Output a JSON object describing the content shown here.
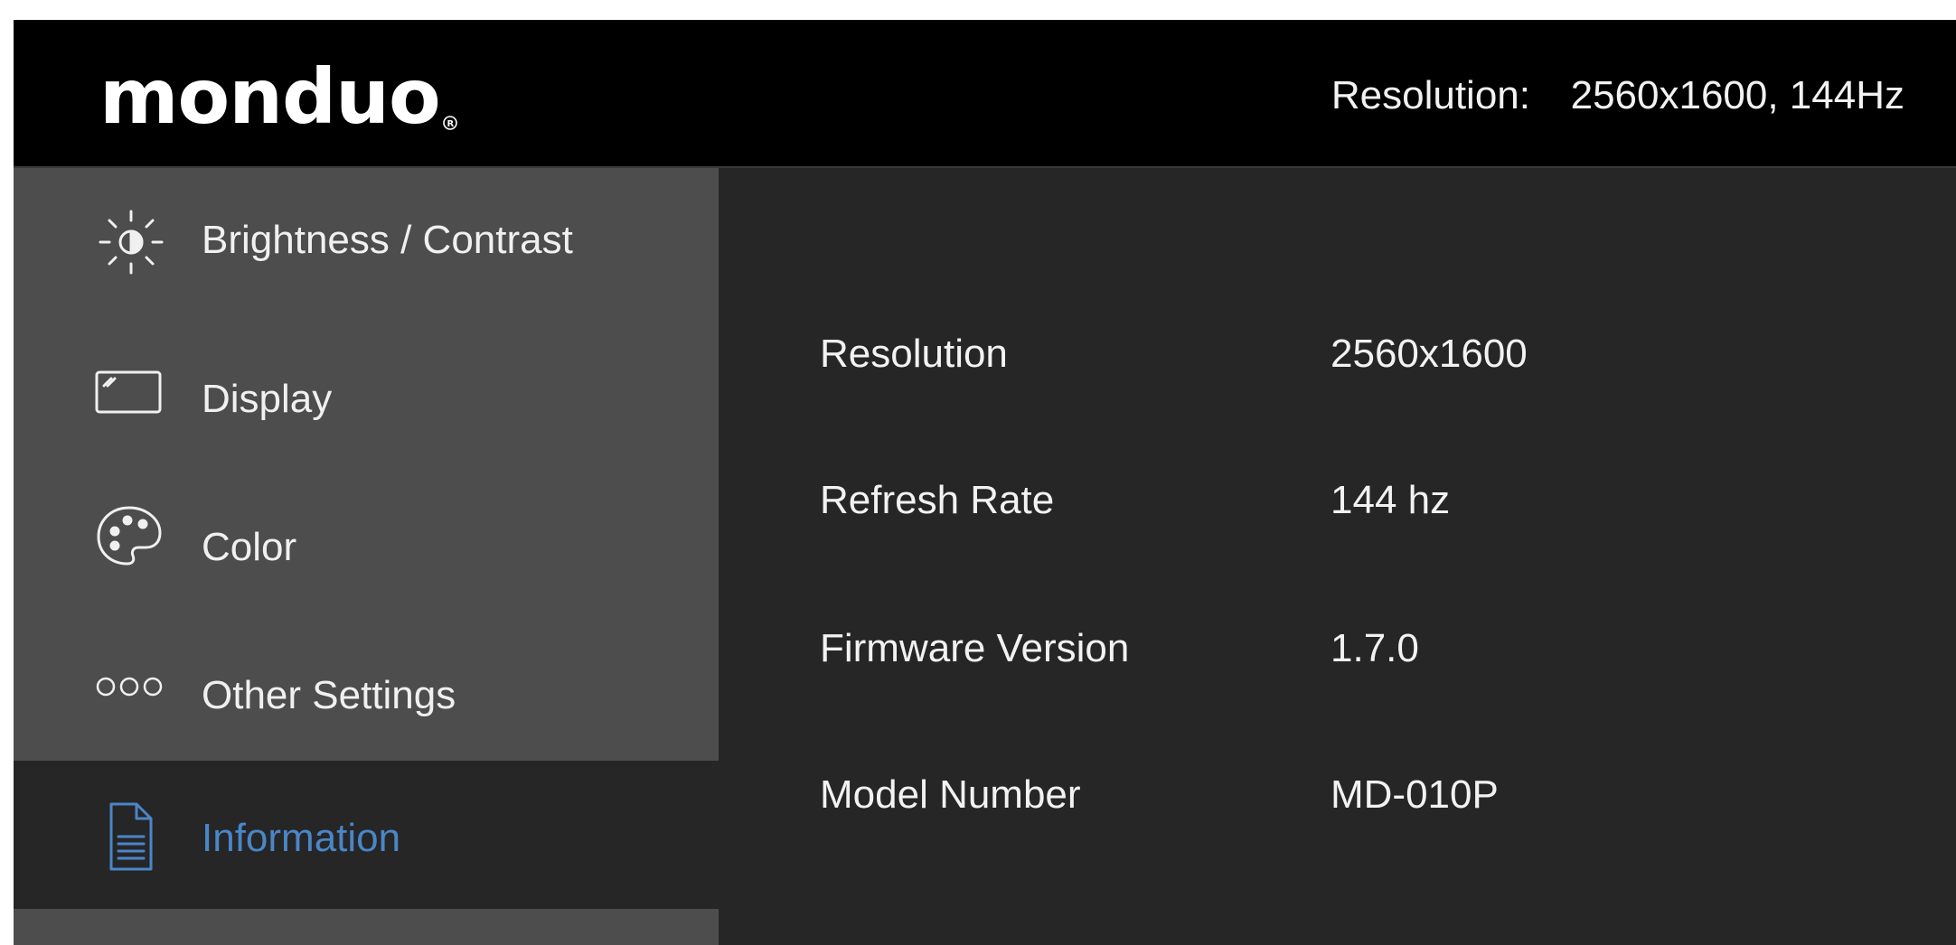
{
  "header": {
    "logo_text": "monduo",
    "resolution_label": "Resolution:",
    "resolution_value": "2560x1600, 144Hz"
  },
  "sidebar": {
    "items": [
      {
        "label": "Brightness / Contrast",
        "icon": "brightness-icon"
      },
      {
        "label": "Display",
        "icon": "display-icon"
      },
      {
        "label": "Color",
        "icon": "palette-icon"
      },
      {
        "label": "Other Settings",
        "icon": "more-dots-icon"
      },
      {
        "label": "Information",
        "icon": "document-icon",
        "active": true
      }
    ]
  },
  "info": {
    "rows": [
      {
        "label": "Resolution",
        "value": "2560x1600"
      },
      {
        "label": "Refresh Rate",
        "value": "144 hz"
      },
      {
        "label": "Firmware Version",
        "value": "1.7.0"
      },
      {
        "label": "Model Number",
        "value": "MD-010P"
      }
    ]
  },
  "colors": {
    "accent": "#4a86c8",
    "header_bg": "#000000",
    "sidebar_bg": "#4d4d4d",
    "content_bg": "#262626"
  }
}
